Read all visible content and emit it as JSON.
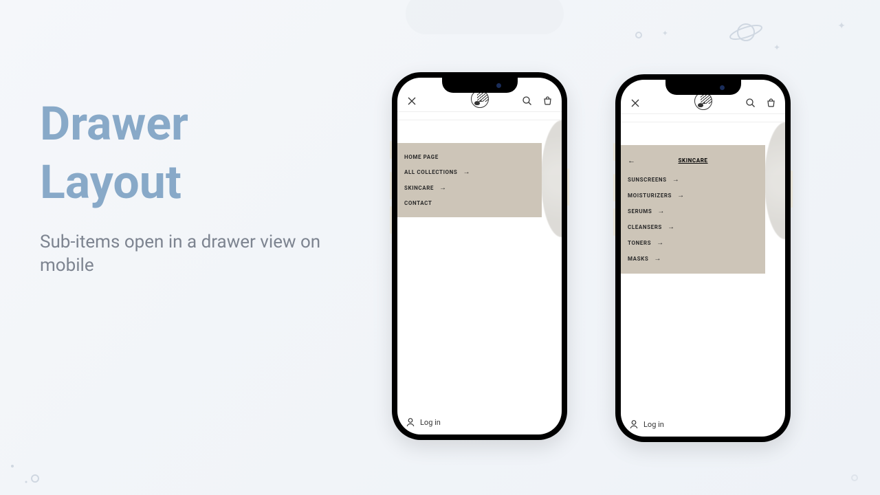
{
  "heading": {
    "title_line1": "Drawer",
    "title_line2": "Layout",
    "subtitle": "Sub-items open in a drawer view on mobile"
  },
  "phone_left": {
    "nav": [
      {
        "label": "HOME PAGE",
        "has_children": false
      },
      {
        "label": "ALL COLLECTIONS",
        "has_children": true
      },
      {
        "label": "SKINCARE",
        "has_children": true
      },
      {
        "label": "CONTACT",
        "has_children": false
      }
    ],
    "login": "Log in"
  },
  "phone_right": {
    "submenu_title": "SKINCARE",
    "items": [
      {
        "label": "SUNSCREENS"
      },
      {
        "label": "MOISTURIZERS"
      },
      {
        "label": "SERUMS"
      },
      {
        "label": "CLEANSERS"
      },
      {
        "label": "TONERS"
      },
      {
        "label": "MASKS"
      }
    ],
    "login": "Log in"
  }
}
